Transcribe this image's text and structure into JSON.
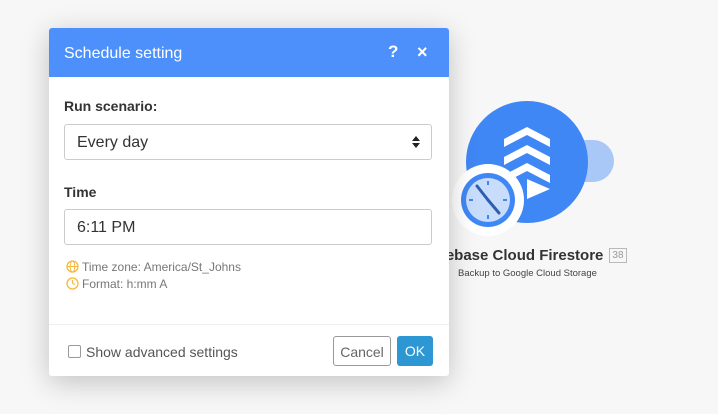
{
  "modal": {
    "title": "Schedule setting",
    "help_label": "?",
    "close_label": "×",
    "run_scenario": {
      "label": "Run scenario:",
      "selected": "Every day"
    },
    "time": {
      "label": "Time",
      "value": "6:11 PM"
    },
    "hints": {
      "timezone": "Time zone: America/St_Johns",
      "format": "Format: h:mm A"
    },
    "footer": {
      "advanced_label": "Show advanced settings",
      "advanced_checked": false,
      "cancel_label": "Cancel",
      "ok_label": "OK"
    }
  },
  "module": {
    "title": "rebase Cloud Firestore",
    "badge": "38",
    "subtitle": "Backup to Google Cloud Storage",
    "icon": "firebase-cloud-firestore-icon",
    "trigger_icon": "clock-icon"
  },
  "colors": {
    "header": "#4d90fb",
    "module": "#3f87f5",
    "ok_button": "#2d97d4",
    "hint_icon": "#f5b93d"
  }
}
